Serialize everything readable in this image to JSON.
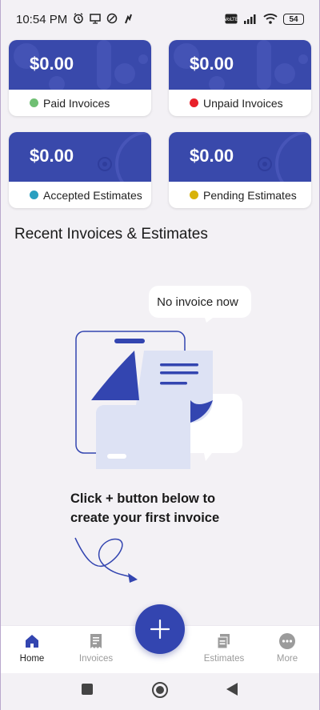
{
  "status_bar": {
    "time": "10:54 PM",
    "battery": "54",
    "icons": [
      "alarm-icon",
      "screen-icon",
      "data-saver-icon",
      "notification-icon",
      "volte-icon",
      "signal-icon",
      "wifi-icon",
      "battery-icon"
    ]
  },
  "cards": [
    {
      "amount": "$0.00",
      "label": "Paid Invoices",
      "dot_color": "#6fbf73"
    },
    {
      "amount": "$0.00",
      "label": "Unpaid Invoices",
      "dot_color": "#e8202a"
    },
    {
      "amount": "$0.00",
      "label": "Accepted Estimates",
      "dot_color": "#2a9fc0"
    },
    {
      "amount": "$0.00",
      "label": "Pending Estimates",
      "dot_color": "#d8b20a"
    }
  ],
  "section_title": "Recent Invoices & Estimates",
  "empty_state": {
    "bubble": "No invoice now",
    "cta_line1": "Click + button below to",
    "cta_line2": "create your first invoice"
  },
  "bottom_nav": {
    "items": [
      {
        "label": "Home",
        "icon": "home-icon",
        "active": true
      },
      {
        "label": "Invoices",
        "icon": "receipt-icon",
        "active": false
      },
      {
        "label": "Estimates",
        "icon": "estimate-icon",
        "active": false
      },
      {
        "label": "More",
        "icon": "more-icon",
        "active": false
      }
    ],
    "fab_icon": "plus-icon"
  },
  "colors": {
    "brand": "#3949ab",
    "background": "#f3f1f5"
  }
}
